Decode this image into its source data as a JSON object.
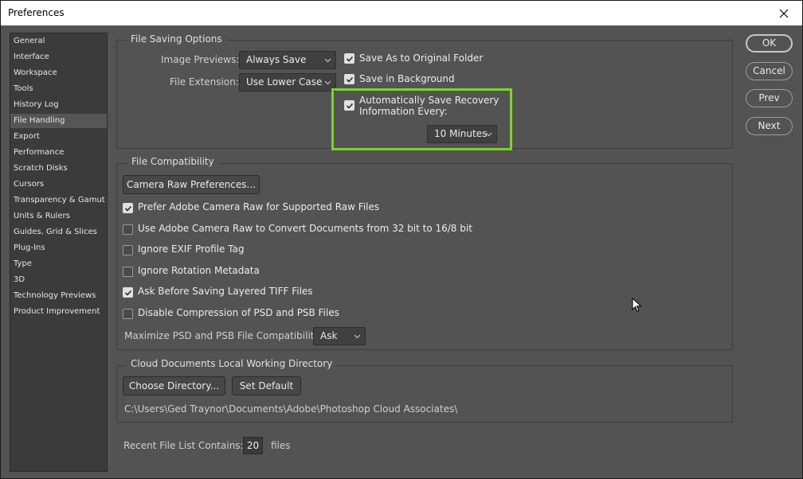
{
  "window": {
    "title": "Preferences"
  },
  "sidebar": {
    "items": [
      {
        "label": "General"
      },
      {
        "label": "Interface"
      },
      {
        "label": "Workspace"
      },
      {
        "label": "Tools"
      },
      {
        "label": "History Log"
      },
      {
        "label": "File Handling",
        "active": true
      },
      {
        "label": "Export"
      },
      {
        "label": "Performance"
      },
      {
        "label": "Scratch Disks"
      },
      {
        "label": "Cursors"
      },
      {
        "label": "Transparency & Gamut"
      },
      {
        "label": "Units & Rulers"
      },
      {
        "label": "Guides, Grid & Slices"
      },
      {
        "label": "Plug-Ins"
      },
      {
        "label": "Type"
      },
      {
        "label": "3D"
      },
      {
        "label": "Technology Previews"
      },
      {
        "label": "Product Improvement"
      }
    ]
  },
  "file_saving": {
    "title": "File Saving Options",
    "image_previews_label": "Image Previews:",
    "image_previews_value": "Always Save",
    "file_extension_label": "File Extension:",
    "file_extension_value": "Use Lower Case",
    "save_as_original": {
      "label": "Save As to Original Folder",
      "checked": true
    },
    "save_in_background": {
      "label": "Save in Background",
      "checked": true
    },
    "auto_save": {
      "label_line1": "Automatically Save Recovery",
      "label_line2": "Information Every:",
      "checked": true
    },
    "auto_save_interval": "10 Minutes"
  },
  "file_compat": {
    "title": "File Compatibility",
    "camera_raw_button": "Camera Raw Preferences...",
    "options": [
      {
        "label": "Prefer Adobe Camera Raw for Supported Raw Files",
        "checked": true
      },
      {
        "label": "Use Adobe Camera Raw to Convert Documents from 32 bit to 16/8 bit",
        "checked": false
      },
      {
        "label": "Ignore EXIF Profile Tag",
        "checked": false
      },
      {
        "label": "Ignore Rotation Metadata",
        "checked": false
      },
      {
        "label": "Ask Before Saving Layered TIFF Files",
        "checked": true
      },
      {
        "label": "Disable Compression of PSD and PSB Files",
        "checked": false
      }
    ],
    "maximize_label": "Maximize PSD and PSB File Compatibility:",
    "maximize_value": "Ask"
  },
  "cloud_docs": {
    "title": "Cloud Documents Local Working Directory",
    "choose_button": "Choose Directory...",
    "default_button": "Set Default",
    "path": "C:\\Users\\Ged Traynor\\Documents\\Adobe\\Photoshop Cloud Associates\\"
  },
  "recent_files": {
    "label": "Recent File List Contains:",
    "value": "20",
    "suffix": "files"
  },
  "actions": {
    "ok": "OK",
    "cancel": "Cancel",
    "prev": "Prev",
    "next": "Next"
  },
  "colors": {
    "highlight": "#7cd42b",
    "background": "#535353"
  },
  "icons": {
    "close": "close-icon",
    "chevron": "chevron-down-icon",
    "check": "checkmark-icon",
    "cursor": "mouse-pointer-icon"
  }
}
